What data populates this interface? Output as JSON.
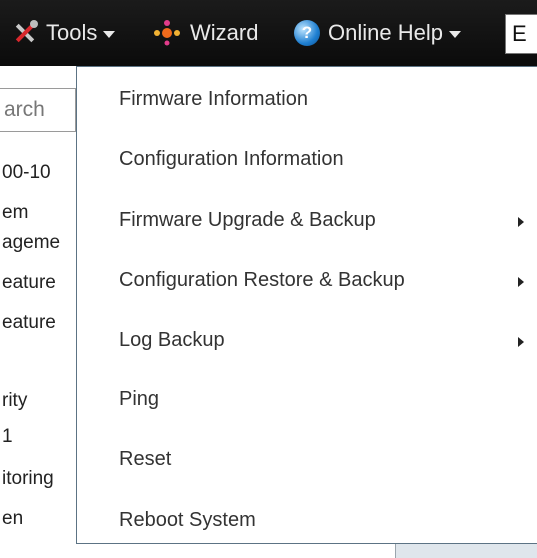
{
  "toolbar": {
    "tools_label": "Tools",
    "wizard_label": "Wizard",
    "help_label": "Online Help",
    "search_fragment": "E"
  },
  "sidebar": {
    "search_placeholder": "arch",
    "items": [
      "00-10",
      "em",
      "ageme",
      "eature",
      "eature",
      "rity",
      "1",
      "itoring",
      "en"
    ]
  },
  "menu": {
    "items": [
      {
        "label": "Firmware Information",
        "has_submenu": false
      },
      {
        "label": "Configuration Information",
        "has_submenu": false
      },
      {
        "label": "Firmware Upgrade & Backup",
        "has_submenu": true
      },
      {
        "label": "Configuration Restore & Backup",
        "has_submenu": true
      },
      {
        "label": "Log Backup",
        "has_submenu": true
      },
      {
        "label": "Ping",
        "has_submenu": false
      },
      {
        "label": "Reset",
        "has_submenu": false
      },
      {
        "label": "Reboot System",
        "has_submenu": false
      }
    ]
  }
}
